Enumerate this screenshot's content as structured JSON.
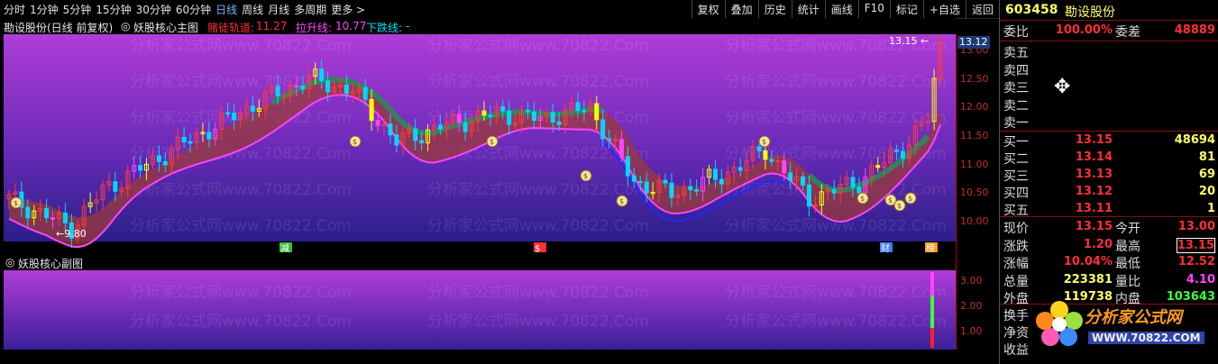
{
  "toolbar": {
    "periods": [
      "分时",
      "1分钟",
      "5分钟",
      "15分钟",
      "30分钟",
      "60分钟",
      "日线",
      "周线",
      "月线",
      "多周期",
      "更多 >"
    ],
    "active_period": "日线",
    "buttons": [
      "复权",
      "叠加",
      "历史",
      "统计",
      "画线",
      "F10",
      "标记",
      "+自选",
      "返回"
    ]
  },
  "infobar": {
    "stock_title": "勘设股份(日线 前复权)",
    "indicator_name": "妖股核心主图",
    "line1_label": "赌徒轨道:",
    "line1_value": "11.27",
    "line2_label": "拉升线:",
    "line2_value": "10.77",
    "line3_label": "下跌线:",
    "line3_value": "-"
  },
  "colors": {
    "up": "#ff3b3b",
    "down": "#00d8ff",
    "accent": "#ff3030",
    "yellow": "#ffff00",
    "purple": "#cc44ff",
    "green": "#3cff3c"
  },
  "main_axis": {
    "ticks": [
      "13.00",
      "12.50",
      "12.00",
      "11.50",
      "11.00",
      "10.50",
      "10.00"
    ],
    "current_price": "13.12"
  },
  "annotations": {
    "high_label": "13.15",
    "low_label": "9.80"
  },
  "markers": [
    "减",
    "$",
    "财",
    "榜"
  ],
  "sub": {
    "title": "妖股核心副图",
    "ticks": [
      "3.00",
      "2.00",
      "1.00"
    ]
  },
  "watermark": "分析家公式网www.70822.Com",
  "panel": {
    "code": "603458",
    "name": "勘设股份",
    "ratio_label": "委比",
    "ratio_value": "100.00%",
    "diff_label": "委差",
    "diff_value": "48889",
    "sells": [
      "卖五",
      "卖四",
      "卖三",
      "卖二",
      "卖一"
    ],
    "buys": [
      {
        "label": "买一",
        "price": "13.15",
        "vol": "48694"
      },
      {
        "label": "买二",
        "price": "13.14",
        "vol": "81"
      },
      {
        "label": "买三",
        "price": "13.13",
        "vol": "69"
      },
      {
        "label": "买四",
        "price": "13.12",
        "vol": "20"
      },
      {
        "label": "买五",
        "price": "13.11",
        "vol": "1"
      }
    ],
    "stats": [
      {
        "k1": "现价",
        "v1": "13.15",
        "k2": "今开",
        "v2": "13.00"
      },
      {
        "k1": "涨跌",
        "v1": "1.20",
        "k2": "最高",
        "v2": "13.15"
      },
      {
        "k1": "涨幅",
        "v1": "10.04%",
        "k2": "最低",
        "v2": "12.52"
      },
      {
        "k1": "总量",
        "v1": "223381",
        "k2": "量比",
        "v2": "4.10"
      },
      {
        "k1": "外盘",
        "v1": "119738",
        "k2": "内盘",
        "v2": "103643"
      }
    ],
    "extra": [
      "换手",
      "净资",
      "收益"
    ],
    "logo_text": "分析家公式网",
    "logo_url": "WWW.70822.COM"
  }
}
